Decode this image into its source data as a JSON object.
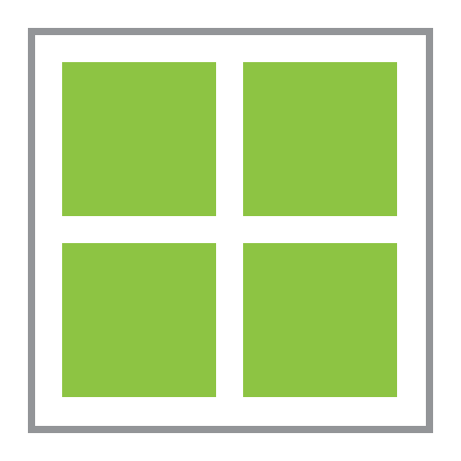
{
  "icon": {
    "name": "grid-view-icon",
    "colors": {
      "frame": "#939598",
      "background": "#ffffff",
      "tile": "#8dc443"
    },
    "tiles": [
      "top-left",
      "top-right",
      "bottom-left",
      "bottom-right"
    ]
  }
}
